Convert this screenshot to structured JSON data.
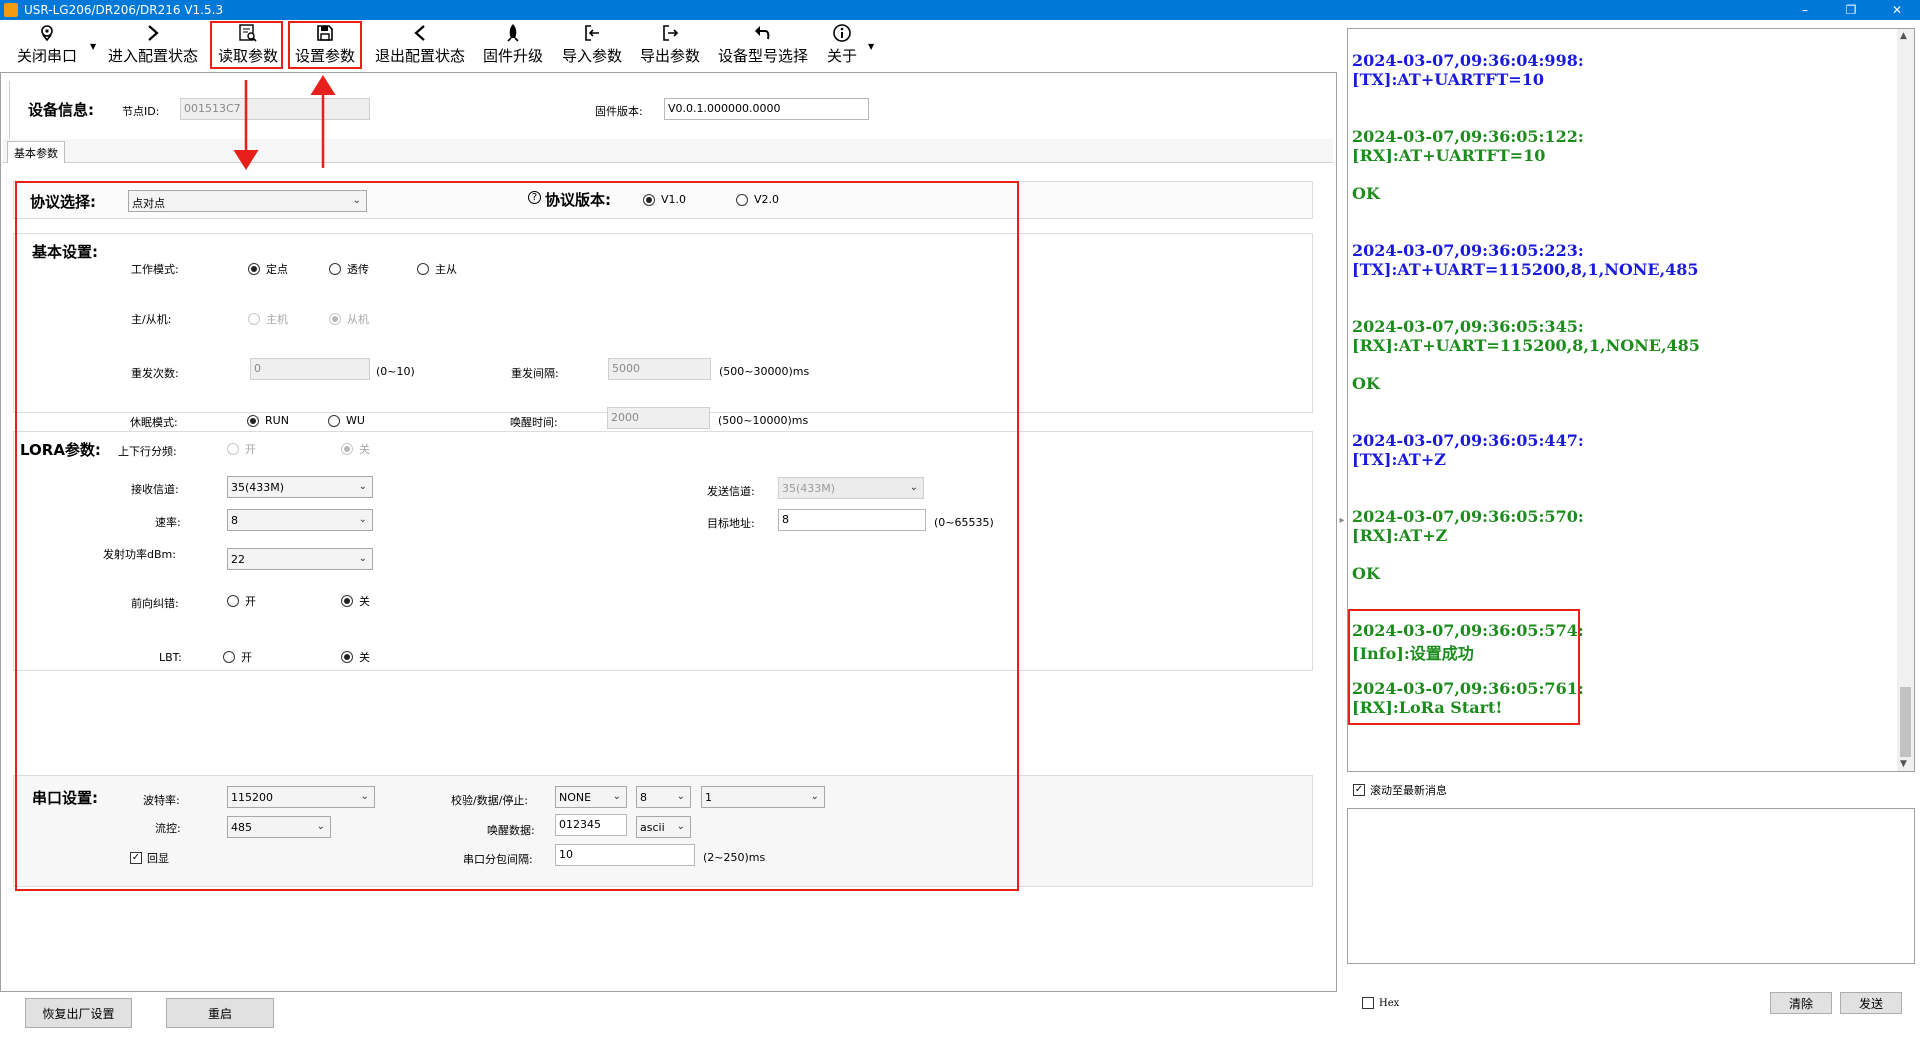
{
  "window": {
    "title": "USR-LG206/DR206/DR216 V1.5.3",
    "minimize": "–",
    "restore": "❐",
    "close": "✕"
  },
  "toolbar": {
    "close_port": "关闭串口",
    "enter_config": "进入配置状态",
    "read_params": "读取参数",
    "set_params": "设置参数",
    "exit_config": "退出配置状态",
    "firmware_upgrade": "固件升级",
    "import_params": "导入参数",
    "export_params": "导出参数",
    "device_model": "设备型号选择",
    "about": "关于"
  },
  "device_info": {
    "label": "设备信息:",
    "node_id_label": "节点ID:",
    "node_id_value": "001513C7",
    "firmware_label": "固件版本:",
    "firmware_value": "V0.0.1.000000.0000"
  },
  "tabs": [
    "基本参数"
  ],
  "protocol": {
    "label": "协议选择:",
    "selected": "点对点",
    "version_label": "协议版本:",
    "v1": "V1.0",
    "v2": "V2.0",
    "help_icon": "?"
  },
  "basic": {
    "label": "基本设置:",
    "work_mode_label": "工作模式:",
    "mode_fixed": "定点",
    "mode_transparent": "透传",
    "mode_master_slave": "主从",
    "master_slave_label": "主/从机:",
    "master": "主机",
    "slave": "从机",
    "retry_count_label": "重发次数:",
    "retry_count_value": "0",
    "retry_count_range": "(0~10)",
    "retry_interval_label": "重发间隔:",
    "retry_interval_value": "5000",
    "retry_interval_range": "(500~30000)ms",
    "sleep_mode_label": "休眠模式:",
    "sleep_run": "RUN",
    "sleep_wu": "WU",
    "wake_time_label": "唤醒时间:",
    "wake_time_value": "2000",
    "wake_time_range": "(500~10000)ms"
  },
  "lora": {
    "label": "LORA参数:",
    "updown_label": "上下行分频:",
    "on": "开",
    "off": "关",
    "rx_channel_label": "接收信道:",
    "rx_channel_value": "35(433M)",
    "tx_channel_label": "发送信道:",
    "tx_channel_value": "35(433M)",
    "rate_label": "速率:",
    "rate_value": "8",
    "target_addr_label": "目标地址:",
    "target_addr_value": "8",
    "target_addr_range": "(0~65535)",
    "power_label": "发射功率dBm:",
    "power_value": "22",
    "fec_label": "前向纠错:",
    "lbt_label": "LBT:"
  },
  "serial": {
    "label": "串口设置:",
    "baud_label": "波特率:",
    "baud_value": "115200",
    "parity_label": "校验/数据/停止:",
    "parity_value": "NONE",
    "data_bits_value": "8",
    "stop_bits_value": "1",
    "flow_label": "流控:",
    "flow_value": "485",
    "wake_data_label": "唤醒数据:",
    "wake_data_value": "012345",
    "wake_data_format": "ascii",
    "echo_label": "回显",
    "packet_interval_label": "串口分包间隔:",
    "packet_interval_value": "10",
    "packet_interval_range": "(2~250)ms"
  },
  "bottom_buttons": {
    "factory_reset": "恢复出厂设置",
    "restart": "重启"
  },
  "log": {
    "entries": [
      {
        "time": "2024-03-07,09:36:04:998:",
        "msg": "[TX]:AT+UARTFT=10",
        "kind": "tx"
      },
      {
        "time": "2024-03-07,09:36:05:122:",
        "msg": "[RX]:AT+UARTFT=10",
        "kind": "rx",
        "extra": "OK"
      },
      {
        "time": "2024-03-07,09:36:05:223:",
        "msg": "[TX]:AT+UART=115200,8,1,NONE,485",
        "kind": "tx"
      },
      {
        "time": "2024-03-07,09:36:05:345:",
        "msg": "[RX]:AT+UART=115200,8,1,NONE,485",
        "kind": "rx",
        "extra": "OK"
      },
      {
        "time": "2024-03-07,09:36:05:447:",
        "msg": "[TX]:AT+Z",
        "kind": "tx"
      },
      {
        "time": "2024-03-07,09:36:05:570:",
        "msg": "[RX]:AT+Z",
        "kind": "rx",
        "extra": "OK"
      },
      {
        "time": "2024-03-07,09:36:05:574:",
        "msg": "[Info]:设置成功",
        "kind": "rx"
      },
      {
        "time": "2024-03-07,09:36:05:761:",
        "msg": "[RX]:LoRa Start!",
        "kind": "rx"
      }
    ],
    "autoscroll_label": "滚动至最新消息",
    "hex_label": "Hex",
    "clear_button": "清除",
    "send_button": "发送"
  },
  "colors": {
    "titlebar": "#0078d7",
    "annotation_red": "#e8201c",
    "log_tx": "#1a1adc",
    "log_rx": "#1c8c1c"
  }
}
